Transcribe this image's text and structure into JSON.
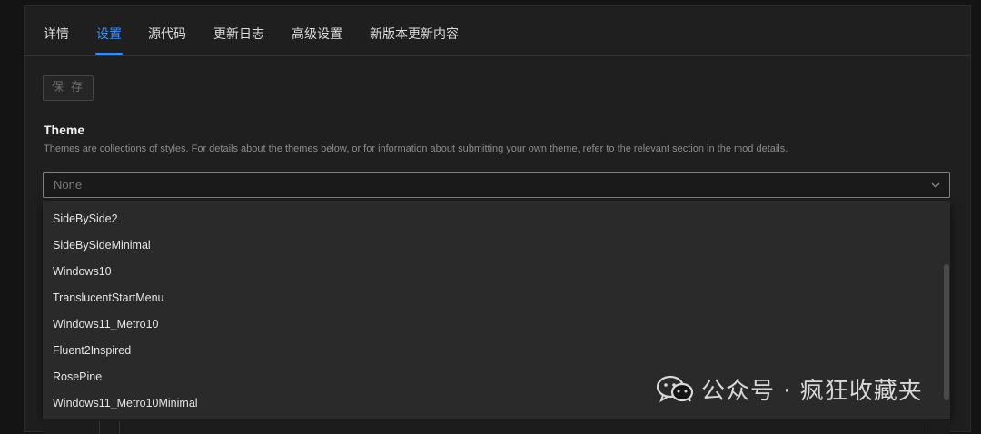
{
  "tabs": [
    {
      "label": "详情"
    },
    {
      "label": "设置"
    },
    {
      "label": "源代码"
    },
    {
      "label": "更新日志"
    },
    {
      "label": "高级设置"
    },
    {
      "label": "新版本更新内容"
    }
  ],
  "active_tab": "设置",
  "toolbar": {
    "save_label": "保 存"
  },
  "theme": {
    "title": "Theme",
    "description": "Themes are collections of styles. For details about the themes below, or for information about submitting your own theme, refer to the relevant section in the mod details.",
    "selected_value": "None",
    "options": [
      "SideBySide2",
      "SideBySideMinimal",
      "Windows10",
      "TranslucentStartMenu",
      "Windows11_Metro10",
      "Fluent2Inspired",
      "RosePine",
      "Windows11_Metro10Minimal"
    ]
  },
  "colors": {
    "accent": "#3d8ef0",
    "panel_background": "#1f1f1f",
    "dropdown_background": "#2a2a2a"
  },
  "icons": {
    "select_chevron": "chevron-down-icon",
    "watermark_logo": "wechat-icon"
  },
  "watermark": {
    "text": "公众号 · 疯狂收藏夹"
  }
}
